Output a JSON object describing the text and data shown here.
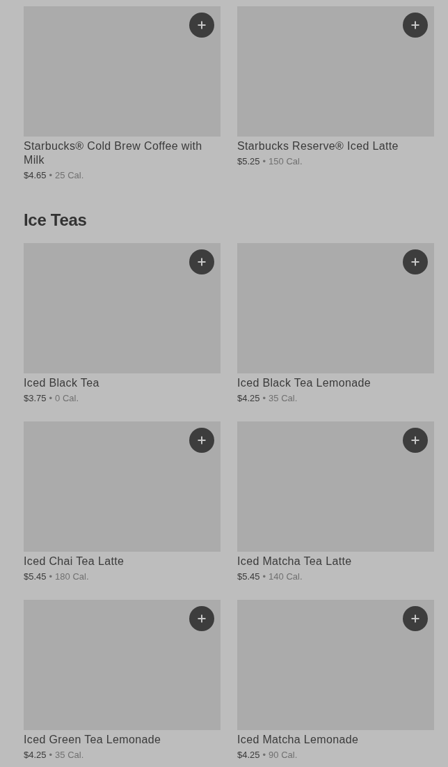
{
  "sections": [
    {
      "items": [
        {
          "name": "Starbucks® Cold Brew Coffee with Milk",
          "price": "$4.65",
          "separator": "•",
          "calories": "25 Cal."
        },
        {
          "name": "Starbucks Reserve® Iced Latte",
          "price": "$5.25",
          "separator": "•",
          "calories": "150 Cal."
        }
      ]
    },
    {
      "title": "Ice Teas",
      "items": [
        {
          "name": "Iced Black Tea",
          "price": "$3.75",
          "separator": "•",
          "calories": "0 Cal."
        },
        {
          "name": "Iced Black Tea Lemonade",
          "price": "$4.25",
          "separator": "•",
          "calories": "35 Cal."
        },
        {
          "name": "Iced Chai Tea Latte",
          "price": "$5.45",
          "separator": "•",
          "calories": "180 Cal."
        },
        {
          "name": "Iced Matcha Tea Latte",
          "price": "$5.45",
          "separator": "•",
          "calories": "140 Cal."
        },
        {
          "name": "Iced Green Tea Lemonade",
          "price": "$4.25",
          "separator": "•",
          "calories": "35 Cal."
        },
        {
          "name": "Iced Matcha Lemonade",
          "price": "$4.25",
          "separator": "•",
          "calories": "90 Cal."
        }
      ]
    }
  ]
}
